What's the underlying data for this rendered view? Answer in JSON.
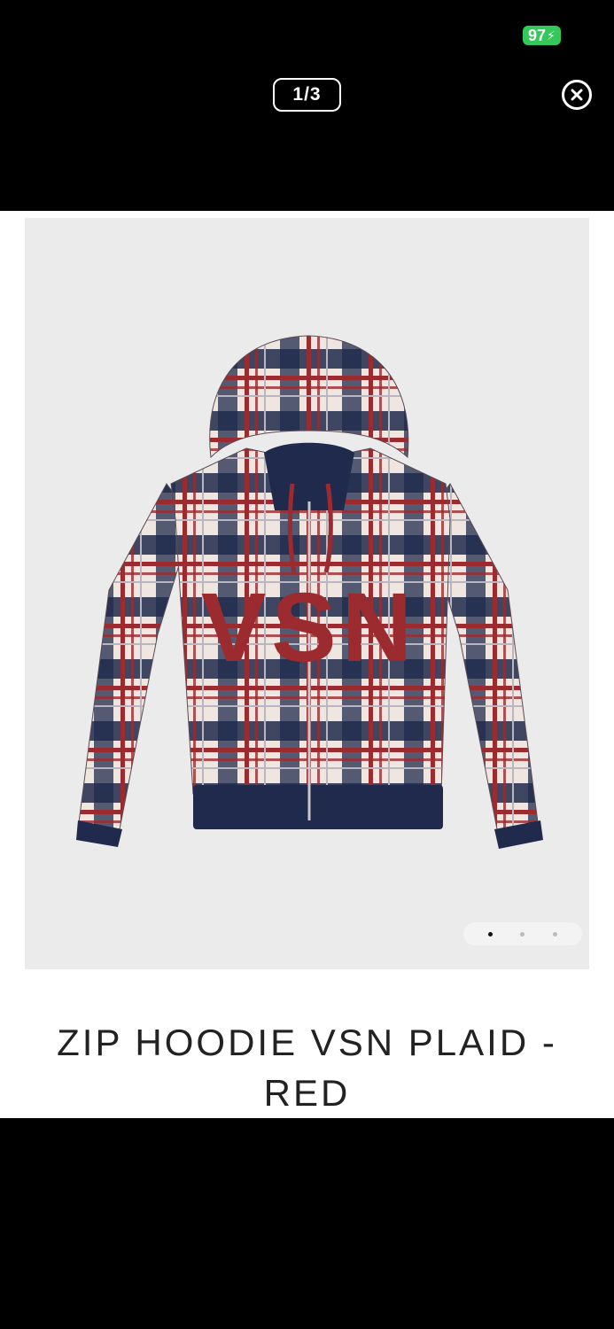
{
  "status_bar": {
    "battery_level": "97"
  },
  "gallery": {
    "counter": "1/3",
    "close_icon": "close-circle-icon",
    "total_images": 3,
    "active_index": 0
  },
  "product": {
    "title": "ZIP HOODIE VSN PLAID - RED",
    "print_text": "VSN"
  },
  "colors": {
    "battery": "#34c759",
    "navy": "#1f2a4d",
    "red": "#9b2b2f",
    "cream": "#efe7df",
    "image_bg": "#ebebeb"
  }
}
